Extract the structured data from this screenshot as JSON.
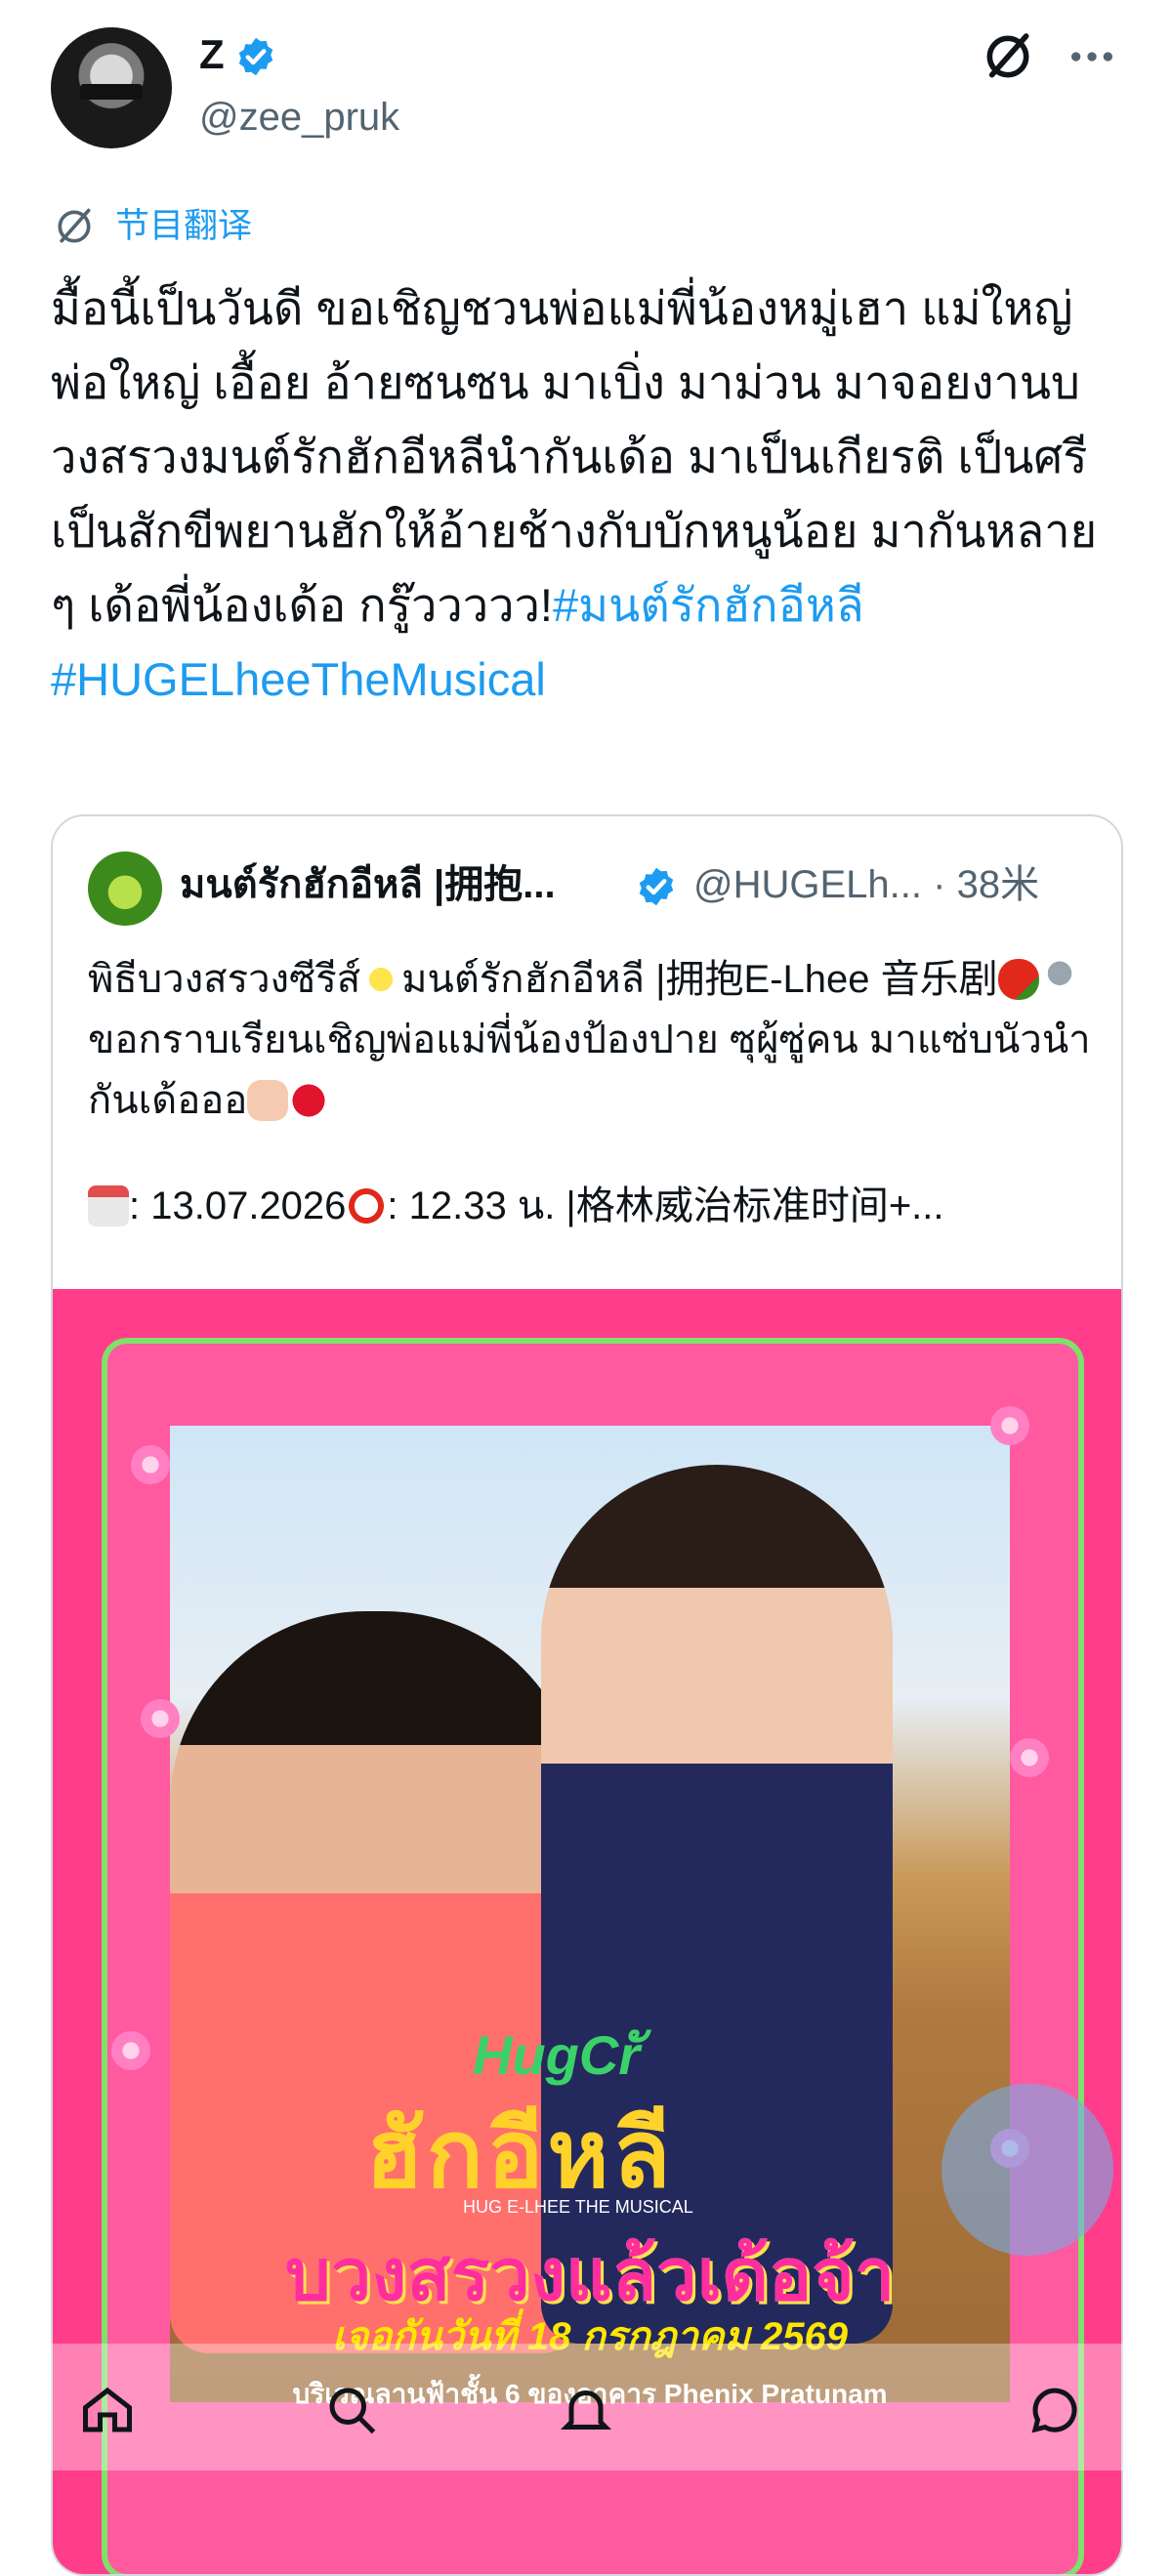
{
  "tweet": {
    "author_name": "Z",
    "author_handle": "@zee_pruk",
    "translate_label": "节目翻译",
    "body": "มื้อนี้เป็นวันดี ขอเชิญชวนพ่อแม่พี่น้องหมู่เฮา แม่ใหญ่ พ่อใหญ่ เอื้อย อ้ายซนซน มาเบิ่ง มาม่วน มาจอยงานบวงสรวงมนต์รักฮักอีหลีนำกันเด้อ มาเป็นเกียรติ เป็นศรี เป็นสักขีพยานฮักให้อ้ายช้างกับบักหนูน้อย มากันหลาย ๆ เด้อพี่น้องเด้อ กรู๊ววววว!",
    "hashtag1": "#มนต์รักฮักอีหลี",
    "hashtag2": "#HUGELheeTheMusical"
  },
  "quote": {
    "author_name": "มนต์รักฮักอีหลี |拥抱...",
    "author_handle": "@HUGELh...",
    "time": "· 38米",
    "body_part1": "พิธีบวงสรวงซีรีส์",
    "body_part2": "มนต์รักฮักอีหลี |拥抱E-Lhee 音乐剧",
    "body_part3": "ขอกราบเรียนเชิญพ่อแม่พี่น้องป้องปาย ซุผู้ซู่คน มาแซ่บนัวนำกันเด้อออ",
    "date_label": ": 13.07.2026",
    "time_label": ": 12.33 น. |格林威治标准时间+..."
  },
  "poster": {
    "logo_small": "HugCrั",
    "logo_big": "ฮักอีหลี",
    "subtitle": "HUG E-LHEE THE MUSICAL",
    "title": "บวงสรวงแล้วเด้อจ้า",
    "date": "เจอกันวันที่ 18 กรกฎาคม 2569",
    "venue": "บริเวณลานฟ้าชั้น 6 ของอาคาร Phenix Pratunam"
  },
  "icons": {
    "verified": "verified-badge-icon",
    "grok": "grok-icon",
    "more": "more-icon",
    "translate": "translate-icon",
    "home": "home-icon",
    "search": "search-icon",
    "notifications": "notifications-icon",
    "messages": "messages-icon"
  },
  "colors": {
    "accent": "#1d9bf0",
    "secondary_text": "#536471",
    "border": "#cfd9de"
  }
}
